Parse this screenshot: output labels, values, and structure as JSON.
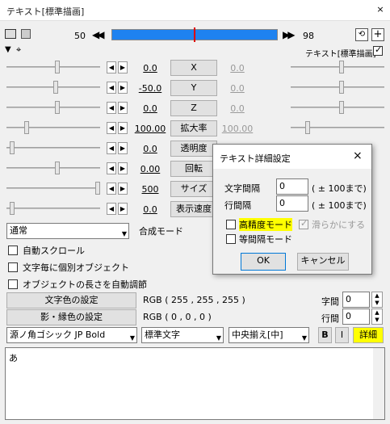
{
  "window": {
    "title": "テキスト[標準描画]",
    "close": "×"
  },
  "timeline": {
    "start": "50",
    "end": "98",
    "prev": "◀◀",
    "next": "▶▶",
    "layer_label": "テキスト[標準描画]"
  },
  "params": [
    {
      "value": "0.0",
      "label": "X",
      "right": "0.0"
    },
    {
      "value": "-50.0",
      "label": "Y",
      "right": "0.0"
    },
    {
      "value": "0.0",
      "label": "Z",
      "right": "0.0"
    },
    {
      "value": "100.00",
      "label": "拡大率",
      "right": "100.00"
    },
    {
      "value": "0.0",
      "label": "透明度",
      "right": ""
    },
    {
      "value": "0.00",
      "label": "回転",
      "right": ""
    },
    {
      "value": "500",
      "label": "サイズ",
      "right": ""
    },
    {
      "value": "0.0",
      "label": "表示速度",
      "right": ""
    }
  ],
  "blend": {
    "value": "通常",
    "label": "合成モード"
  },
  "checks": [
    "自動スクロール",
    "文字毎に個別オブジェクト",
    "オブジェクトの長さを自動調節"
  ],
  "color": {
    "text_btn": "文字色の設定",
    "text_rgb": "RGB ( 255 , 255 , 255 )",
    "shadow_btn": "影・縁色の設定",
    "shadow_rgb": "RGB ( 0 , 0 , 0 )"
  },
  "spacing": {
    "char_label": "字間",
    "char_val": "0",
    "line_label": "行間",
    "line_val": "0"
  },
  "font": {
    "name": "源ノ角ゴシック JP Bold",
    "style": "標準文字",
    "align": "中央揃え[中]",
    "bold": "B",
    "italic": "I",
    "detail": "詳細"
  },
  "text_content": "あ",
  "dialog": {
    "title": "テキスト詳細設定",
    "close": "×",
    "char_spacing_label": "文字間隔",
    "char_spacing_val": "0",
    "char_spacing_hint": "( ± 100まで)",
    "line_spacing_label": "行間隔",
    "line_spacing_val": "0",
    "line_spacing_hint": "( ± 100まで)",
    "hq_mode": "高精度モード",
    "smooth": "滑らかにする",
    "mono_mode": "等間隔モード",
    "ok": "OK",
    "cancel": "キャンセル"
  }
}
